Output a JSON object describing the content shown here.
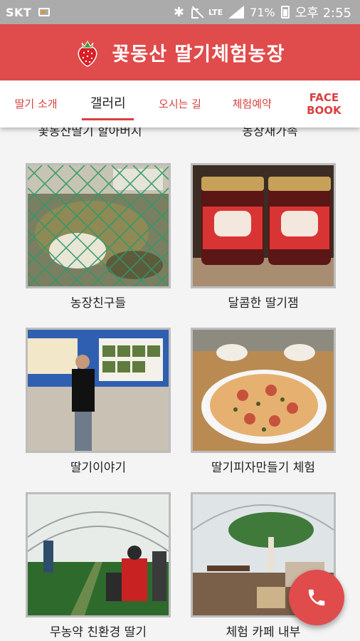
{
  "status_bar": {
    "carrier": "SKT",
    "network": "LTE",
    "battery": "71%",
    "time": "오후 2:55"
  },
  "app_bar": {
    "title": "꽃동산 딸기체험농장",
    "logo_icon": "strawberry-icon"
  },
  "tabs": [
    {
      "label": "딸기 소개",
      "active": false
    },
    {
      "label": "갤러리",
      "active": true
    },
    {
      "label": "오시는 길",
      "active": false
    },
    {
      "label": "체험예약",
      "active": false
    },
    {
      "label": "FACE\nBOOK",
      "active": false
    }
  ],
  "gallery": {
    "partial_captions": [
      "꽃동산딸기 할아버지",
      "농장새가족"
    ],
    "items": [
      {
        "caption": "농장친구들"
      },
      {
        "caption": "달콤한 딸기잼"
      },
      {
        "caption": "딸기이야기"
      },
      {
        "caption": "딸기피자만들기 체험"
      },
      {
        "caption": "무농약 친환경 딸기"
      },
      {
        "caption": "체험 카페 내부"
      }
    ]
  },
  "fab": {
    "icon": "phone-icon"
  },
  "colors": {
    "accent": "#e04b4b",
    "status_bar": "#ababab"
  }
}
